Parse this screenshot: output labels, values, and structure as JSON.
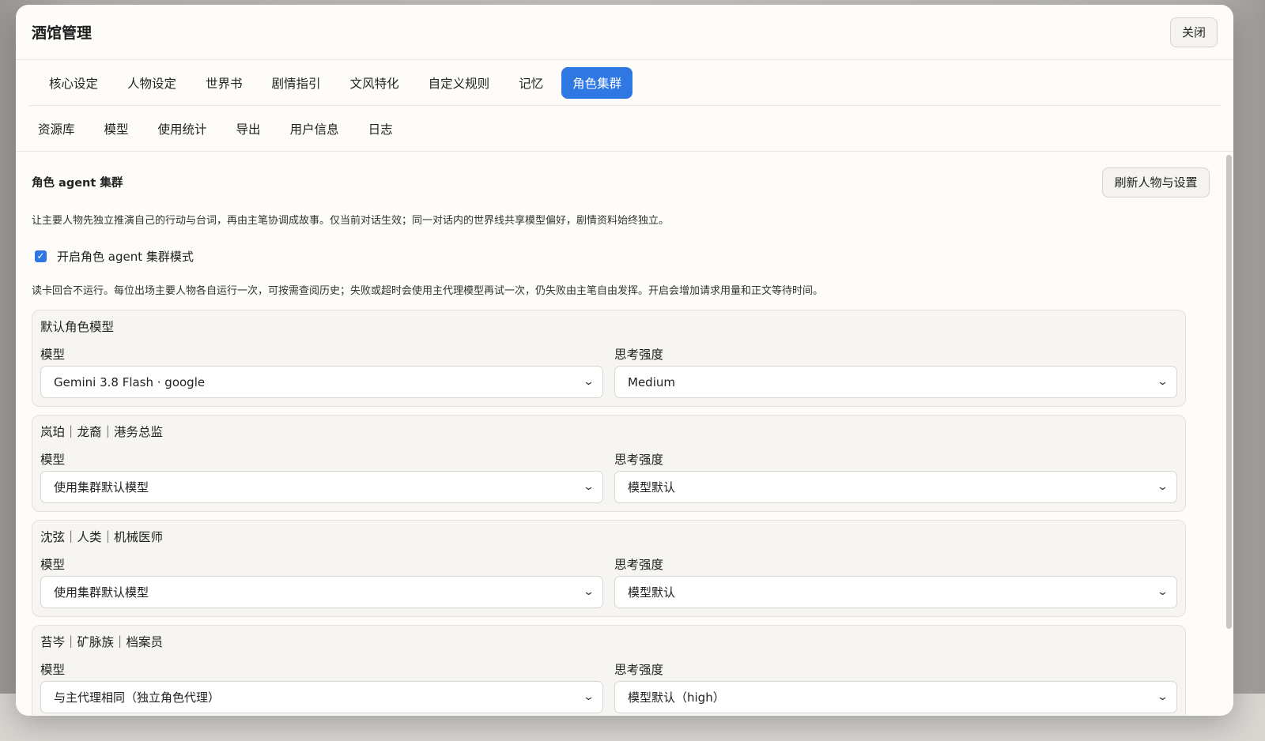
{
  "modal": {
    "title": "酒馆管理",
    "close_label": "关闭"
  },
  "tabs": [
    "核心设定",
    "人物设定",
    "世界书",
    "剧情指引",
    "文风特化",
    "自定义规则",
    "记忆",
    "角色集群"
  ],
  "active_tab": "角色集群",
  "subtabs": [
    "资源库",
    "模型",
    "使用统计",
    "导出",
    "用户信息",
    "日志"
  ],
  "section": {
    "title": "角色 agent 集群",
    "refresh_label": "刷新人物与设置",
    "description": "让主要人物先独立推演自己的行动与台词，再由主笔协调成故事。仅当前对话生效；同一对话内的世界线共享模型偏好，剧情资料始终独立。",
    "enable_label": "开启角色 agent 集群模式",
    "enabled": true,
    "note": "读卡回合不运行。每位出场主要人物各自运行一次，可按需查阅历史；失败或超时会使用主代理模型再试一次，仍失败由主笔自由发挥。开启会增加请求用量和正文等待时间。"
  },
  "field_labels": {
    "model": "模型",
    "thinking": "思考强度"
  },
  "cards": [
    {
      "title": "默认角色模型",
      "model": "Gemini 3.8 Flash · google",
      "thinking": "Medium"
    },
    {
      "title": "岚珀｜龙裔｜港务总监",
      "model": "使用集群默认模型",
      "thinking": "模型默认"
    },
    {
      "title": "沈弦｜人类｜机械医师",
      "model": "使用集群默认模型",
      "thinking": "模型默认"
    },
    {
      "title": "苔岑｜矿脉族｜档案员",
      "model": "与主代理相同（独立角色代理）",
      "thinking": "模型默认（high）"
    }
  ],
  "colors": {
    "accent": "#2f78e4",
    "modal_bg": "#fdfcf8",
    "card_bg": "#f6f5f1"
  }
}
